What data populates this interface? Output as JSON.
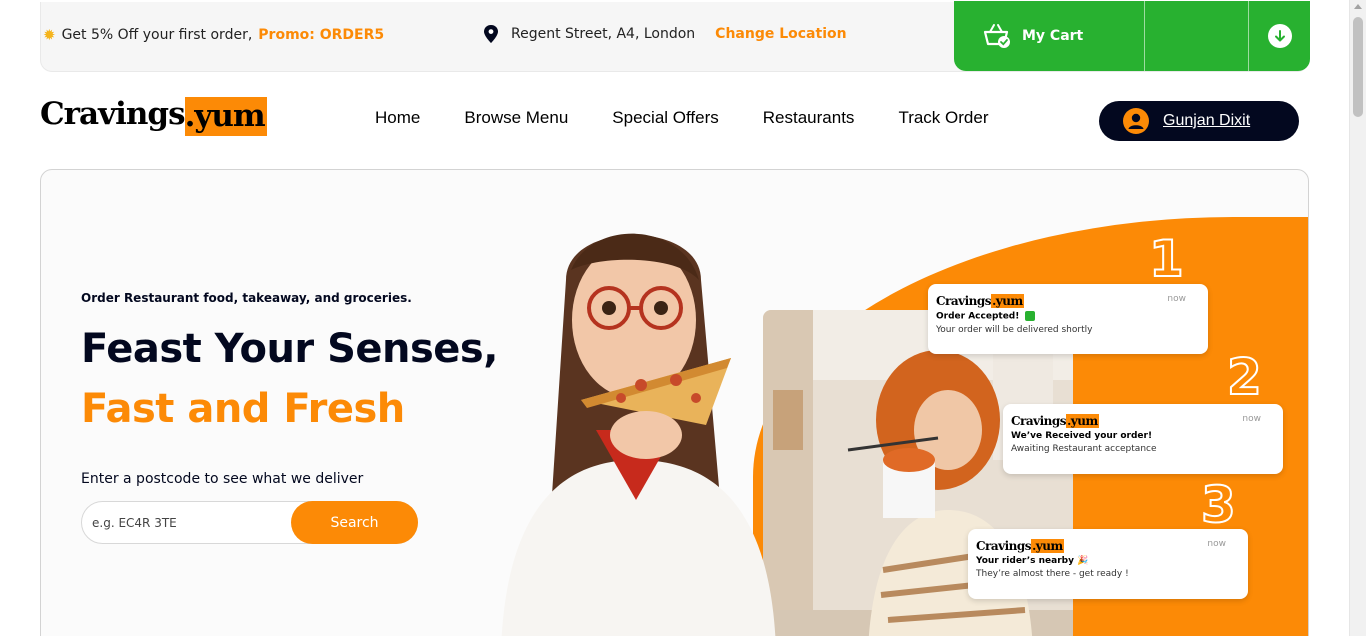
{
  "topbar": {
    "promo_text": "Get 5% Off your first order,",
    "promo_code": "Promo: ORDER5",
    "location": "Regent Street, A4, London",
    "change_location": "Change Location",
    "cart_label": "My Cart"
  },
  "header": {
    "logo_part1": "Cravings",
    "logo_part2": ".yum",
    "nav": [
      "Home",
      "Browse Menu",
      "Special Offers",
      "Restaurants",
      "Track Order"
    ],
    "user_name": "Gunjan Dixit"
  },
  "hero": {
    "subtitle": "Order Restaurant food, takeaway, and groceries.",
    "title_line1": "Feast Your Senses,",
    "title_line2": "Fast and Fresh",
    "postcode_label": "Enter a postcode to see what we deliver",
    "search_placeholder": "e.g. EC4R 3TE",
    "search_button": "Search",
    "step_numbers": [
      "1",
      "2",
      "3"
    ],
    "notifications": [
      {
        "logo1": "Cravings",
        "logo2": ".yum",
        "time": "now",
        "title": "Order Accepted!",
        "body": "Your order will be delivered shortly"
      },
      {
        "logo1": "Cravings",
        "logo2": ".yum",
        "time": "now",
        "title": "We’ve Received your order!",
        "body": "Awaiting Restaurant acceptance"
      },
      {
        "logo1": "Cravings",
        "logo2": ".yum",
        "time": "now",
        "title": "Your rider’s nearby 🎉",
        "body": "They’re almost there - get ready !"
      }
    ]
  },
  "colors": {
    "accent_orange": "#fc8a06",
    "cart_green": "#28b130",
    "dark_navy": "#03081f"
  },
  "icons": [
    "sun-icon",
    "location-pin-icon",
    "basket-icon",
    "download-arrow-icon",
    "user-icon",
    "check-icon"
  ]
}
